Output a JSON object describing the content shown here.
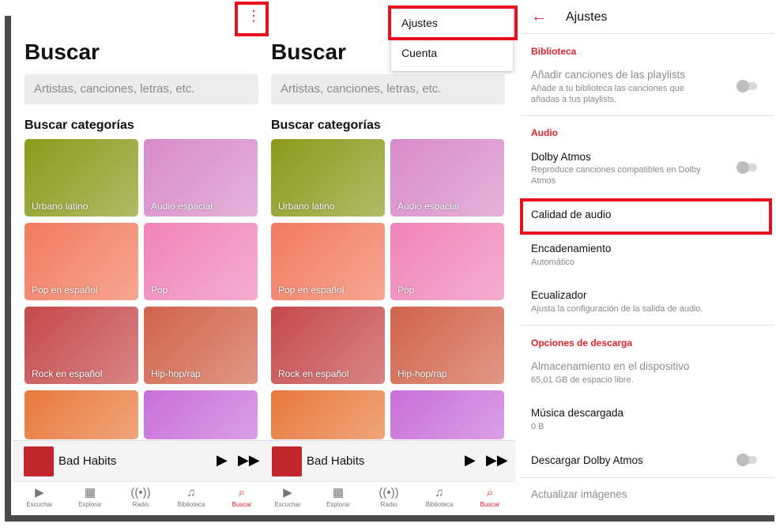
{
  "search_screen": {
    "title": "Buscar",
    "search_placeholder": "Artistas, canciones, letras, etc.",
    "categories_title": "Buscar categorías",
    "tiles": [
      {
        "label": "Urbano latino",
        "color": "#8a9a1a"
      },
      {
        "label": "Audio espacial",
        "color": "#d88bc9"
      },
      {
        "label": "Pop en español",
        "color": "#f27a5e"
      },
      {
        "label": "Pop",
        "color": "#f084b8"
      },
      {
        "label": "Rock en español",
        "color": "#c5484a"
      },
      {
        "label": "Hip-hop/rap",
        "color": "#d1634a"
      },
      {
        "label": "",
        "color": "#e8783a"
      },
      {
        "label": "",
        "color": "#c86fd9"
      }
    ],
    "mini_player": {
      "song": "Bad Habits",
      "play_icon": "play-icon",
      "next_icon": "skip-forward-icon"
    },
    "nav": [
      {
        "label": "Escuchar",
        "icon": "play-circle-icon",
        "glyph": "▶"
      },
      {
        "label": "Explorar",
        "icon": "grid-icon",
        "glyph": "▦"
      },
      {
        "label": "Radio",
        "icon": "radio-icon",
        "glyph": "((•))"
      },
      {
        "label": "Biblioteca",
        "icon": "library-icon",
        "glyph": "♫"
      },
      {
        "label": "Buscar",
        "icon": "search-icon",
        "glyph": "⌕",
        "active": true
      }
    ],
    "more_icon_glyph": "⋮"
  },
  "overflow_menu": {
    "items": [
      "Ajustes",
      "Cuenta"
    ]
  },
  "settings_screen": {
    "back_glyph": "←",
    "title": "Ajustes",
    "sections": {
      "biblioteca": "Biblioteca",
      "audio": "Audio",
      "descarga": "Opciones de descarga"
    },
    "rows": {
      "add_songs_title": "Añadir canciones de las playlists",
      "add_songs_sub": "Añade a tu biblioteca las canciones que añadas a tus playlists.",
      "dolby_title": "Dolby Atmos",
      "dolby_sub": "Reproduce canciones compatibles en Dolby Atmos",
      "quality_title": "Calidad de audio",
      "crossfade_title": "Encadenamiento",
      "crossfade_sub": "Automático",
      "eq_title": "Ecualizador",
      "eq_sub": "Ajusta la configuración de la salida de audio.",
      "storage_title": "Almacenamiento en el dispositivo",
      "storage_sub": "65,01 GB de espacio libre.",
      "downloaded_title": "Música descargada",
      "downloaded_sub": "0 B",
      "download_dolby_title": "Descargar Dolby Atmos",
      "update_images_title": "Actualizar imágenes"
    }
  },
  "colors": {
    "accent": "#e0232a",
    "highlight_box": "#e8101d"
  }
}
